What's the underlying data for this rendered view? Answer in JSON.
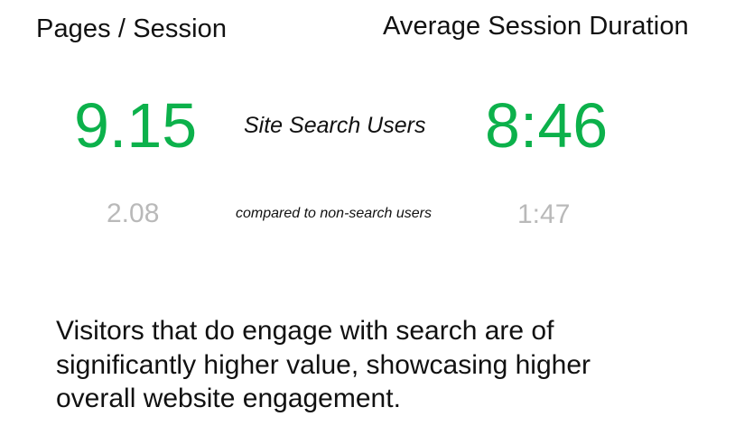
{
  "colors": {
    "accent_green": "#0cb14b",
    "muted_gray": "#b9b9b9",
    "text": "#111111",
    "background": "#ffffff"
  },
  "metrics": {
    "pages_per_session": {
      "label": "Pages / Session",
      "search_users_value": "9.15",
      "non_search_users_value": "2.08"
    },
    "avg_session_duration": {
      "label": "Average Session Duration",
      "search_users_value": "8:46",
      "non_search_users_value": "1:47"
    }
  },
  "segment_label": "Site Search Users",
  "comparison_label": "compared to non-search users",
  "summary": {
    "lines": [
      "Visitors that do engage with search are of",
      "significantly higher value, showcasing higher",
      "overall website engagement."
    ]
  }
}
